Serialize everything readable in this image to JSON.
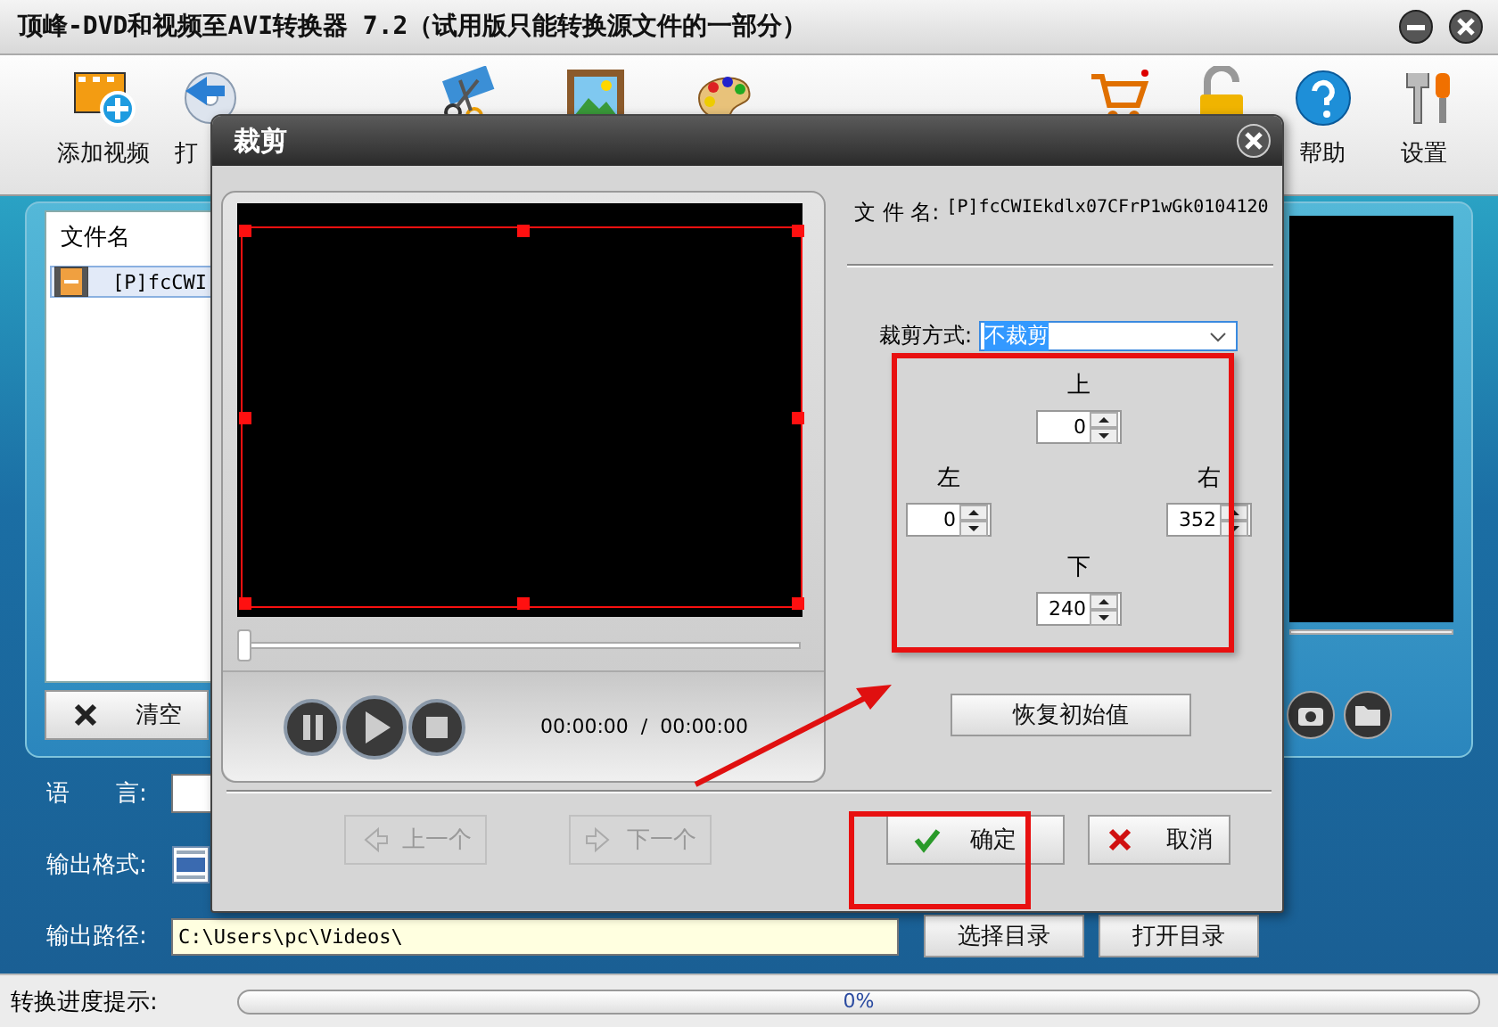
{
  "window": {
    "title": "顶峰-DVD和视频至AVI转换器 7.2（试用版只能转换源文件的一部分）"
  },
  "toolbar": [
    {
      "kind": "add_video",
      "label": "添加视频"
    },
    {
      "kind": "open",
      "label": "打"
    },
    {
      "kind": "cut"
    },
    {
      "kind": "picture"
    },
    {
      "kind": "palette"
    },
    {
      "kind": "cart"
    },
    {
      "kind": "lock"
    },
    {
      "kind": "help",
      "label": "帮助"
    },
    {
      "kind": "settings",
      "label": "设置"
    }
  ],
  "file_list": {
    "columns": [
      "文件名"
    ],
    "rows": [
      {
        "name": "[P]fcCWI",
        "selected": true
      }
    ]
  },
  "clear_button": "清空",
  "output": {
    "language_label": "语　　言:",
    "format_label": "输出格式:",
    "path_label": "输出路径:",
    "path_value": "C:\\Users\\pc\\Videos\\",
    "buttons": [
      "选择目录",
      "打开目录"
    ]
  },
  "status_bar": {
    "label": "转换进度提示:",
    "progress_text": "0%",
    "level": 0
  },
  "dialog": {
    "title": "裁剪",
    "file_label": "文 件 名:",
    "file_name": "[P]fcCWIEkdlx07CFrP1wGk0104120",
    "crop_mode_label": "裁剪方式:",
    "crop_mode": "不裁剪",
    "margins": [
      {
        "kind": "top",
        "label": "上",
        "value": "0"
      },
      {
        "kind": "left",
        "label": "左",
        "value": "0"
      },
      {
        "kind": "right",
        "label": "右",
        "value": "352"
      },
      {
        "kind": "bottom",
        "label": "下",
        "value": "240"
      }
    ],
    "reset_button": "恢复初始值",
    "time": "00:00:00  /  00:00:00",
    "seek": {
      "level": 0
    },
    "buttons": [
      {
        "kind": "prev",
        "label": "上一个",
        "disabled": true
      },
      {
        "kind": "next",
        "label": "下一个",
        "disabled": true
      },
      {
        "kind": "ok",
        "label": "确定",
        "disabled": false
      },
      {
        "kind": "cancel",
        "label": "取消",
        "disabled": false
      }
    ]
  }
}
